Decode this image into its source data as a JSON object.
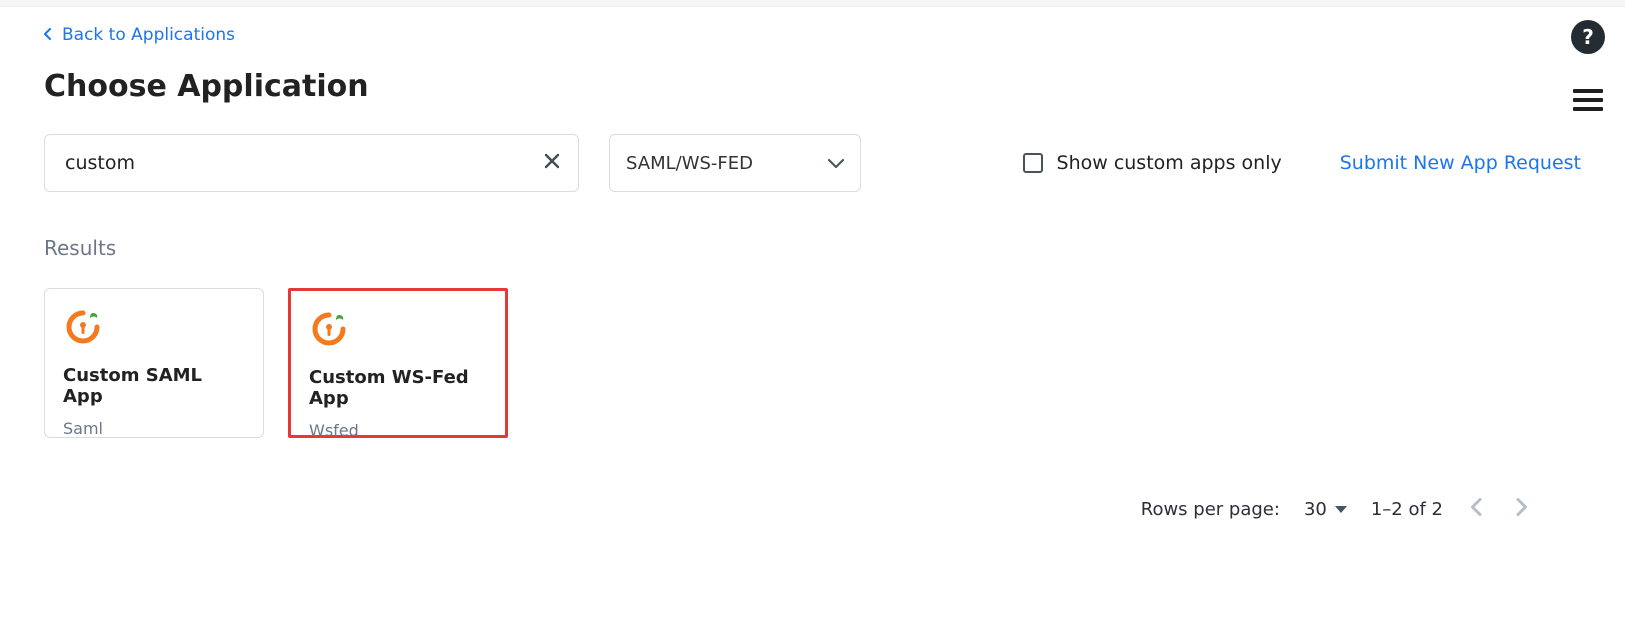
{
  "back_link": "Back to Applications",
  "page_title": "Choose Application",
  "search": {
    "value": "custom"
  },
  "filter": {
    "selected": "SAML/WS-FED"
  },
  "show_custom_only": {
    "label": "Show custom apps only",
    "checked": false
  },
  "submit_link": "Submit New App Request",
  "results_label": "Results",
  "cards": [
    {
      "name": "Custom SAML App",
      "type": "Saml",
      "highlight": false
    },
    {
      "name": "Custom WS-Fed App",
      "type": "Wsfed",
      "highlight": true
    }
  ],
  "pagination": {
    "rows_per_page_label": "Rows per page:",
    "rows_per_page": "30",
    "range": "1–2 of 2"
  }
}
